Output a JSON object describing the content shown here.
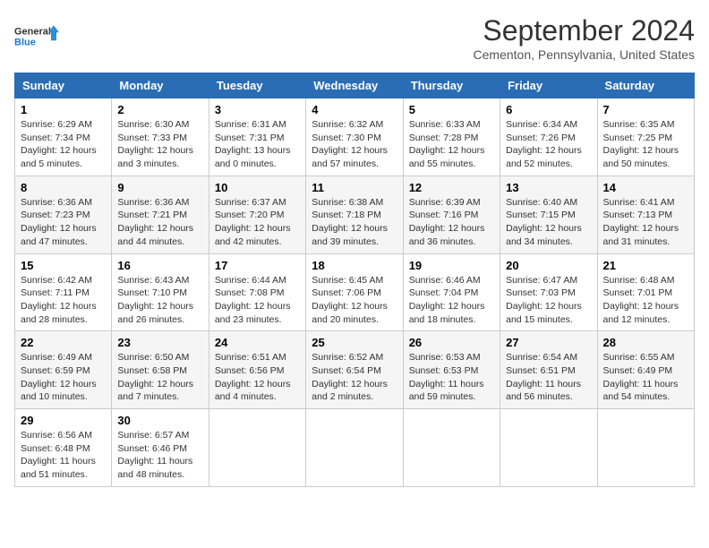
{
  "header": {
    "logo_line1": "General",
    "logo_line2": "Blue",
    "month": "September 2024",
    "location": "Cementon, Pennsylvania, United States"
  },
  "weekdays": [
    "Sunday",
    "Monday",
    "Tuesday",
    "Wednesday",
    "Thursday",
    "Friday",
    "Saturday"
  ],
  "weeks": [
    [
      {
        "day": "1",
        "sunrise": "6:29 AM",
        "sunset": "7:34 PM",
        "daylight": "12 hours and 5 minutes."
      },
      {
        "day": "2",
        "sunrise": "6:30 AM",
        "sunset": "7:33 PM",
        "daylight": "12 hours and 3 minutes."
      },
      {
        "day": "3",
        "sunrise": "6:31 AM",
        "sunset": "7:31 PM",
        "daylight": "13 hours and 0 minutes."
      },
      {
        "day": "4",
        "sunrise": "6:32 AM",
        "sunset": "7:30 PM",
        "daylight": "12 hours and 57 minutes."
      },
      {
        "day": "5",
        "sunrise": "6:33 AM",
        "sunset": "7:28 PM",
        "daylight": "12 hours and 55 minutes."
      },
      {
        "day": "6",
        "sunrise": "6:34 AM",
        "sunset": "7:26 PM",
        "daylight": "12 hours and 52 minutes."
      },
      {
        "day": "7",
        "sunrise": "6:35 AM",
        "sunset": "7:25 PM",
        "daylight": "12 hours and 50 minutes."
      }
    ],
    [
      {
        "day": "8",
        "sunrise": "6:36 AM",
        "sunset": "7:23 PM",
        "daylight": "12 hours and 47 minutes."
      },
      {
        "day": "9",
        "sunrise": "6:36 AM",
        "sunset": "7:21 PM",
        "daylight": "12 hours and 44 minutes."
      },
      {
        "day": "10",
        "sunrise": "6:37 AM",
        "sunset": "7:20 PM",
        "daylight": "12 hours and 42 minutes."
      },
      {
        "day": "11",
        "sunrise": "6:38 AM",
        "sunset": "7:18 PM",
        "daylight": "12 hours and 39 minutes."
      },
      {
        "day": "12",
        "sunrise": "6:39 AM",
        "sunset": "7:16 PM",
        "daylight": "12 hours and 36 minutes."
      },
      {
        "day": "13",
        "sunrise": "6:40 AM",
        "sunset": "7:15 PM",
        "daylight": "12 hours and 34 minutes."
      },
      {
        "day": "14",
        "sunrise": "6:41 AM",
        "sunset": "7:13 PM",
        "daylight": "12 hours and 31 minutes."
      }
    ],
    [
      {
        "day": "15",
        "sunrise": "6:42 AM",
        "sunset": "7:11 PM",
        "daylight": "12 hours and 28 minutes."
      },
      {
        "day": "16",
        "sunrise": "6:43 AM",
        "sunset": "7:10 PM",
        "daylight": "12 hours and 26 minutes."
      },
      {
        "day": "17",
        "sunrise": "6:44 AM",
        "sunset": "7:08 PM",
        "daylight": "12 hours and 23 minutes."
      },
      {
        "day": "18",
        "sunrise": "6:45 AM",
        "sunset": "7:06 PM",
        "daylight": "12 hours and 20 minutes."
      },
      {
        "day": "19",
        "sunrise": "6:46 AM",
        "sunset": "7:04 PM",
        "daylight": "12 hours and 18 minutes."
      },
      {
        "day": "20",
        "sunrise": "6:47 AM",
        "sunset": "7:03 PM",
        "daylight": "12 hours and 15 minutes."
      },
      {
        "day": "21",
        "sunrise": "6:48 AM",
        "sunset": "7:01 PM",
        "daylight": "12 hours and 12 minutes."
      }
    ],
    [
      {
        "day": "22",
        "sunrise": "6:49 AM",
        "sunset": "6:59 PM",
        "daylight": "12 hours and 10 minutes."
      },
      {
        "day": "23",
        "sunrise": "6:50 AM",
        "sunset": "6:58 PM",
        "daylight": "12 hours and 7 minutes."
      },
      {
        "day": "24",
        "sunrise": "6:51 AM",
        "sunset": "6:56 PM",
        "daylight": "12 hours and 4 minutes."
      },
      {
        "day": "25",
        "sunrise": "6:52 AM",
        "sunset": "6:54 PM",
        "daylight": "12 hours and 2 minutes."
      },
      {
        "day": "26",
        "sunrise": "6:53 AM",
        "sunset": "6:53 PM",
        "daylight": "11 hours and 59 minutes."
      },
      {
        "day": "27",
        "sunrise": "6:54 AM",
        "sunset": "6:51 PM",
        "daylight": "11 hours and 56 minutes."
      },
      {
        "day": "28",
        "sunrise": "6:55 AM",
        "sunset": "6:49 PM",
        "daylight": "11 hours and 54 minutes."
      }
    ],
    [
      {
        "day": "29",
        "sunrise": "6:56 AM",
        "sunset": "6:48 PM",
        "daylight": "11 hours and 51 minutes."
      },
      {
        "day": "30",
        "sunrise": "6:57 AM",
        "sunset": "6:46 PM",
        "daylight": "11 hours and 48 minutes."
      },
      null,
      null,
      null,
      null,
      null
    ]
  ]
}
